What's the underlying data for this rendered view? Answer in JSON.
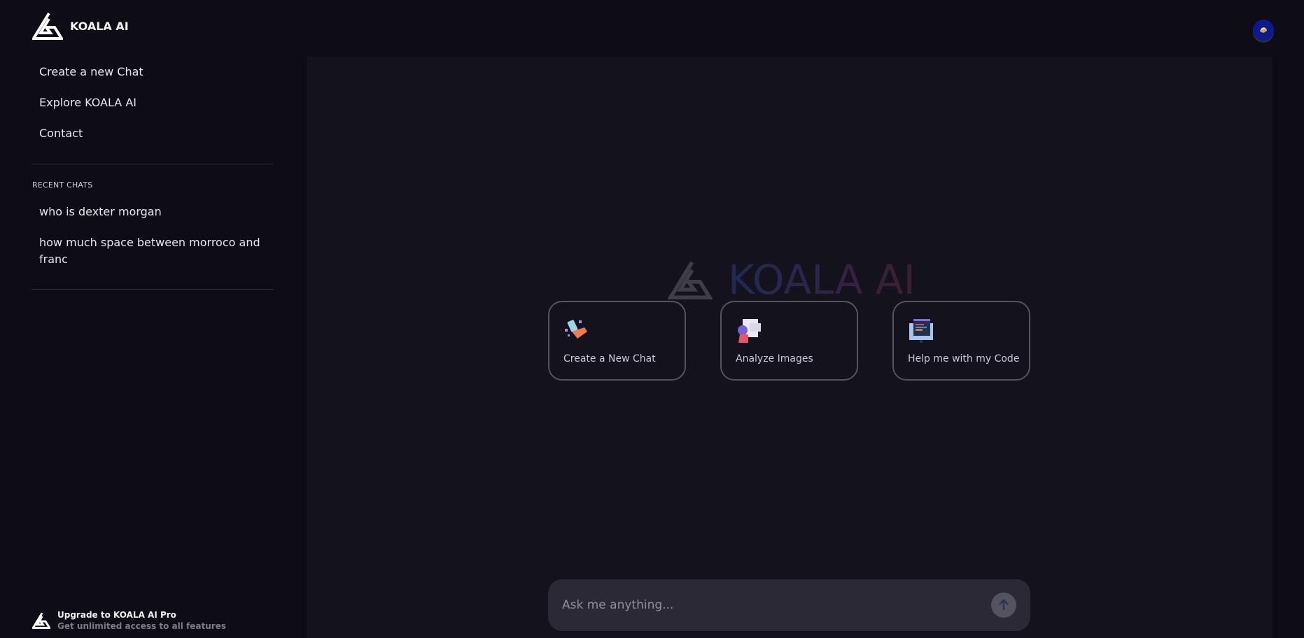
{
  "brand": {
    "name": "KOALA AI"
  },
  "nav": [
    {
      "label": "Create a new Chat"
    },
    {
      "label": "Explore KOALA AI"
    },
    {
      "label": "Contact"
    }
  ],
  "recent": {
    "heading": "RECENT CHATS",
    "items": [
      {
        "label": "who is dexter morgan"
      },
      {
        "label": "how much space between morroco and franc"
      }
    ]
  },
  "watermark": {
    "text": "KOALA AI"
  },
  "cards": [
    {
      "label": "Create a New Chat",
      "icon": "chat-illustration-icon"
    },
    {
      "label": "Analyze Images",
      "icon": "image-analysis-illustration-icon"
    },
    {
      "label": "Help me with my Code",
      "icon": "code-monitor-illustration-icon"
    }
  ],
  "composer": {
    "placeholder": "Ask me anything...",
    "send_icon": "arrow-up-icon"
  },
  "upgrade": {
    "title": "Upgrade to KOALA AI Pro",
    "subtitle": "Get unlimited access to all features"
  },
  "colors": {
    "background": "#0e0d17",
    "panel": "#13121d",
    "input": "#2a2935",
    "card_border": "#55545c"
  }
}
